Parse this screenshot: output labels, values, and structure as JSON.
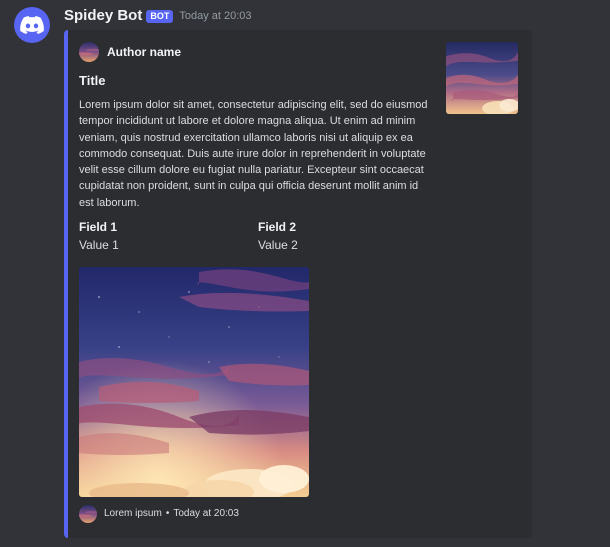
{
  "message": {
    "author": {
      "username": "Spidey Bot",
      "bot_tag": "BOT",
      "avatar_icon": "discord-logo-icon",
      "avatar_color": "#5865F2"
    },
    "timestamp": "Today at 20:03"
  },
  "embed": {
    "accent_color": "#5865F2",
    "author_name": "Author name",
    "author_icon": "sunset-sky-image",
    "title": "Title",
    "description": "Lorem ipsum dolor sit amet, consectetur adipiscing elit, sed do eiusmod tempor incididunt ut labore et dolore magna aliqua. Ut enim ad minim veniam, quis nostrud exercitation ullamco laboris nisi ut aliquip ex ea commodo consequat. Duis aute irure dolor in reprehenderit in voluptate velit esse cillum dolore eu fugiat nulla pariatur. Excepteur sint occaecat cupidatat non proident, sunt in culpa qui officia deserunt mollit anim id est laborum.",
    "fields": [
      {
        "name": "Field 1",
        "value": "Value 1"
      },
      {
        "name": "Field 2",
        "value": "Value 2"
      }
    ],
    "thumbnail": "sunset-sky-image",
    "image": "sunset-sky-image",
    "footer": {
      "text": "Lorem ipsum",
      "separator": "•",
      "timestamp": "Today at 20:03",
      "icon": "sunset-sky-image"
    }
  },
  "colors": {
    "background": "#313338",
    "embed_background": "#2b2d31",
    "text_primary": "#f2f3f5",
    "text_secondary": "#dbdee1",
    "text_muted": "#949ba4",
    "blurple": "#5865F2"
  }
}
